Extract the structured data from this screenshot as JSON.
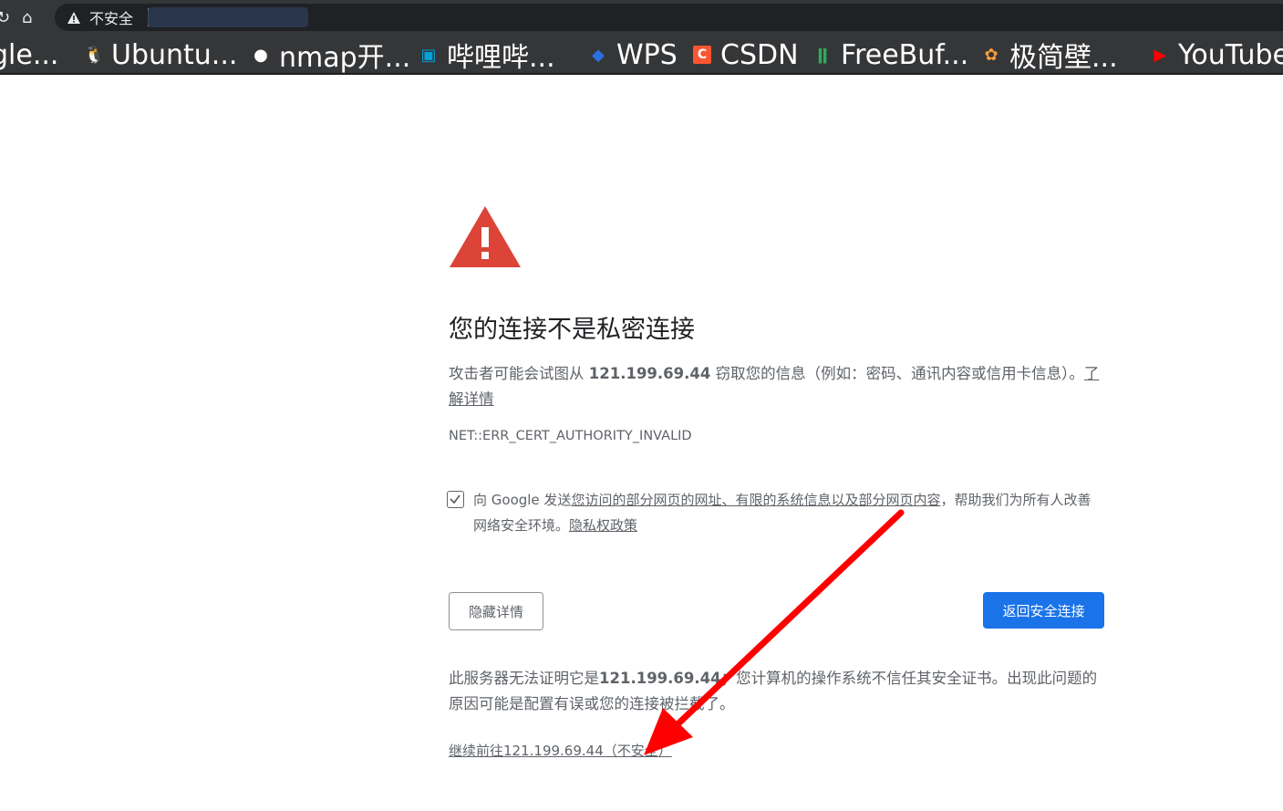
{
  "toolbar": {
    "security_label": "不安全",
    "icons": [
      "reload-icon",
      "home-icon",
      "warning-icon"
    ]
  },
  "bookmarks": [
    {
      "label": "gle...",
      "icon": "google-icon"
    },
    {
      "label": "Ubuntu...",
      "icon": "linux-penguin-icon"
    },
    {
      "label": "nmap开...",
      "icon": "nmap-icon"
    },
    {
      "label": "哔哩哔...",
      "icon": "bilibili-icon"
    },
    {
      "label": "WPS",
      "icon": "wps-icon"
    },
    {
      "label": "CSDN",
      "icon": "csdn-icon"
    },
    {
      "label": "FreeBuf...",
      "icon": "freebuf-icon"
    },
    {
      "label": "极简壁...",
      "icon": "wallpaper-icon"
    },
    {
      "label": "YouTube",
      "icon": "youtube-icon"
    }
  ],
  "interstitial": {
    "heading": "您的连接不是私密连接",
    "explain_prefix": "攻击者可能会试图从 ",
    "host": "121.199.69.44",
    "explain_suffix": " 窃取您的信息（例如：密码、通讯内容或信用卡信息）。",
    "learn_more": "了解详情",
    "error_code": "NET::ERR_CERT_AUTHORITY_INVALID",
    "checkbox_checked": true,
    "checkbox_prefix": "向 Google 发送",
    "checkbox_link": "您访问的部分网页的网址、有限的系统信息以及部分网页内容",
    "checkbox_suffix": "，帮助我们为所有人改善网络安全环境。",
    "privacy_link": "隐私权政策",
    "hide_details_button": "隐藏详情",
    "back_to_safety_button": "返回安全连接",
    "details_prefix": "此服务器无法证明它是",
    "details_host": "121.199.69.44",
    "details_suffix": "；您计算机的操作系统不信任其安全证书。出现此问题的原因可能是配置有误或您的连接被拦截了。",
    "proceed_link": "继续前往121.199.69.44（不安全）"
  },
  "colors": {
    "chrome_bg": "#353638",
    "warning_red": "#db4437",
    "primary_blue": "#1a73e8",
    "text_gray": "#5f6368",
    "annotation_arrow": "#ff0000"
  }
}
